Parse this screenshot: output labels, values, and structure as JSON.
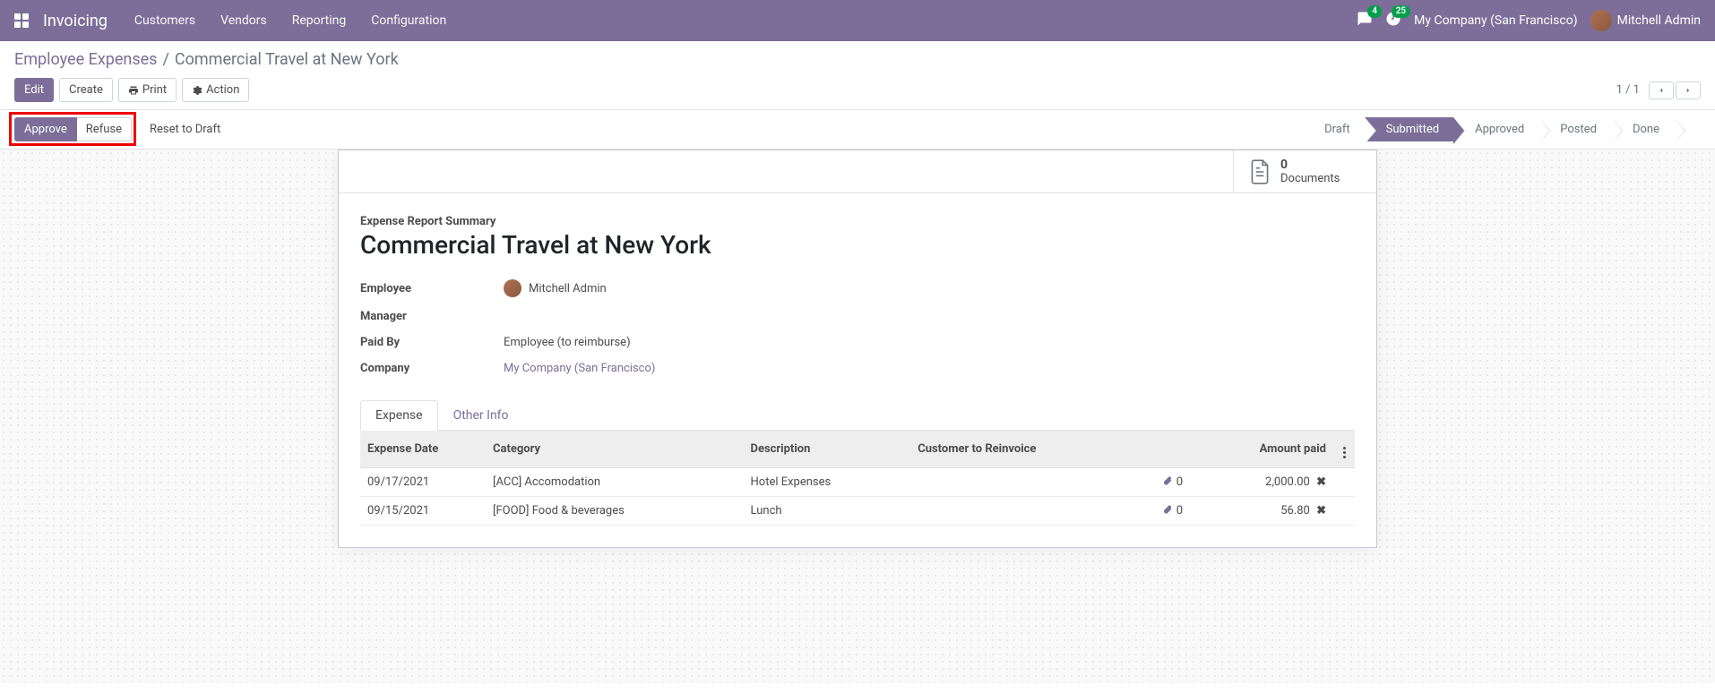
{
  "nav": {
    "brand": "Invoicing",
    "menu": [
      "Customers",
      "Vendors",
      "Reporting",
      "Configuration"
    ],
    "chat_badge": "4",
    "activity_badge": "25",
    "company": "My Company (San Francisco)",
    "user": "Mitchell Admin"
  },
  "breadcrumb": {
    "parent": "Employee Expenses",
    "current": "Commercial Travel at New York"
  },
  "buttons": {
    "edit": "Edit",
    "create": "Create",
    "print": "Print",
    "action": "Action",
    "approve": "Approve",
    "refuse": "Refuse",
    "reset": "Reset to Draft"
  },
  "pager": {
    "value": "1 / 1"
  },
  "status": [
    "Draft",
    "Submitted",
    "Approved",
    "Posted",
    "Done"
  ],
  "status_active_index": 1,
  "docs": {
    "count": "0",
    "label": "Documents"
  },
  "form": {
    "summary_label": "Expense Report Summary",
    "title": "Commercial Travel at New York",
    "labels": {
      "employee": "Employee",
      "manager": "Manager",
      "paid_by": "Paid By",
      "company": "Company"
    },
    "employee": "Mitchell Admin",
    "manager": "",
    "paid_by": "Employee (to reimburse)",
    "company": "My Company (San Francisco)"
  },
  "tabs": [
    "Expense",
    "Other Info"
  ],
  "tabs_active_index": 0,
  "table": {
    "headers": {
      "date": "Expense Date",
      "category": "Category",
      "description": "Description",
      "customer": "Customer to Reinvoice",
      "amount": "Amount paid"
    },
    "rows": [
      {
        "date": "09/17/2021",
        "category": "[ACC] Accomodation",
        "description": "Hotel Expenses",
        "customer": "",
        "attach": "0",
        "amount": "2,000.00"
      },
      {
        "date": "09/15/2021",
        "category": "[FOOD] Food & beverages",
        "description": "Lunch",
        "customer": "",
        "attach": "0",
        "amount": "56.80"
      }
    ]
  }
}
